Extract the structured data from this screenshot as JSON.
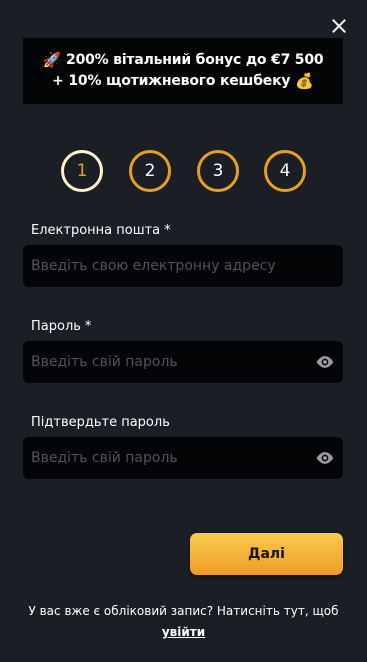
{
  "banner": {
    "line1_icon": "rocket-icon",
    "line1_emoji": "🚀",
    "line1": "200% вітальний бонус до €7 500",
    "line2": "+ 10% щотижневого кешбеку",
    "line2_icon": "money-bag-icon",
    "line2_emoji": "💰"
  },
  "steps": {
    "items": [
      "1",
      "2",
      "3",
      "4"
    ],
    "active": 1
  },
  "form": {
    "email": {
      "label": "Електронна пошта",
      "required_mark": "*",
      "placeholder": "Введіть свою електронну адресу",
      "value": ""
    },
    "password": {
      "label": "Пароль",
      "required_mark": "*",
      "placeholder": "Введіть свій пароль",
      "value": ""
    },
    "confirm": {
      "label": "Підтвердьте пароль",
      "placeholder": "Введіть свій пароль",
      "value": ""
    }
  },
  "actions": {
    "next_label": "Далі"
  },
  "footer": {
    "text": "У вас вже є обліковий запис? Натисніть тут, щоб",
    "link": "увійти"
  },
  "colors": {
    "background": "#1b1e25",
    "field": "#040506",
    "accent": "#e3a124",
    "button_gradient": [
      "#fbcb4f",
      "#ee9c24"
    ]
  },
  "icons": {
    "close": "close-icon",
    "eye": "eye-icon"
  }
}
